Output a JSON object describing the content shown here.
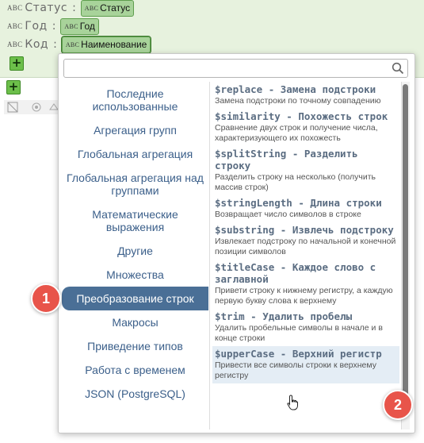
{
  "fields": [
    {
      "label": "Статус",
      "type_badge": "ABC",
      "value": "Статус"
    },
    {
      "label": "Год",
      "type_badge": "ABC",
      "value": "Год"
    },
    {
      "label": "Код",
      "type_badge": "ABC",
      "value": "Наименование"
    }
  ],
  "add_button": "+",
  "search": {
    "value": "",
    "placeholder": ""
  },
  "categories": [
    "Последние использованные",
    "Агрегация групп",
    "Глобальная агрегация",
    "Глобальная агрегация над группами",
    "Математические выражения",
    "Другие",
    "Множества",
    "Преобразование строк",
    "Макросы",
    "Приведение типов",
    "Работа с временем",
    "JSON (PostgreSQL)"
  ],
  "selected_category": "Преобразование строк",
  "functions": [
    {
      "name": "$replace - Замена подстроки",
      "desc": "Замена подстроки по точному совпадению"
    },
    {
      "name": "$similarity - Похожесть строк",
      "desc": "Сравнение двух строк и получение числа, характеризующего их похожесть"
    },
    {
      "name": "$splitString - Разделить строку",
      "desc": "Разделить строку на несколько (получить массив строк)"
    },
    {
      "name": "$stringLength - Длина строки",
      "desc": "Возвращает число символов в строке"
    },
    {
      "name": "$substring - Извлечь подстроку",
      "desc": "Извлекает подстроку по начальной и конечной позиции символов"
    },
    {
      "name": "$titleCase - Каждое слово с заглавной",
      "desc": "Привети строку к нижнему регистру, а каждую первую букву слова к верхнему"
    },
    {
      "name": "$trim - Удалить пробелы",
      "desc": "Удалить пробельные символы в начале и в конце строки"
    },
    {
      "name": "$upperCase - Верхний регистр",
      "desc": "Привести все символы строки к верхнему регистру"
    }
  ],
  "badges": [
    "1",
    "2"
  ],
  "colors": {
    "accent_selected": "#4a6f96",
    "badge": "#e8544a",
    "chip": "#a8d39a",
    "panel": "#e7f2de"
  }
}
